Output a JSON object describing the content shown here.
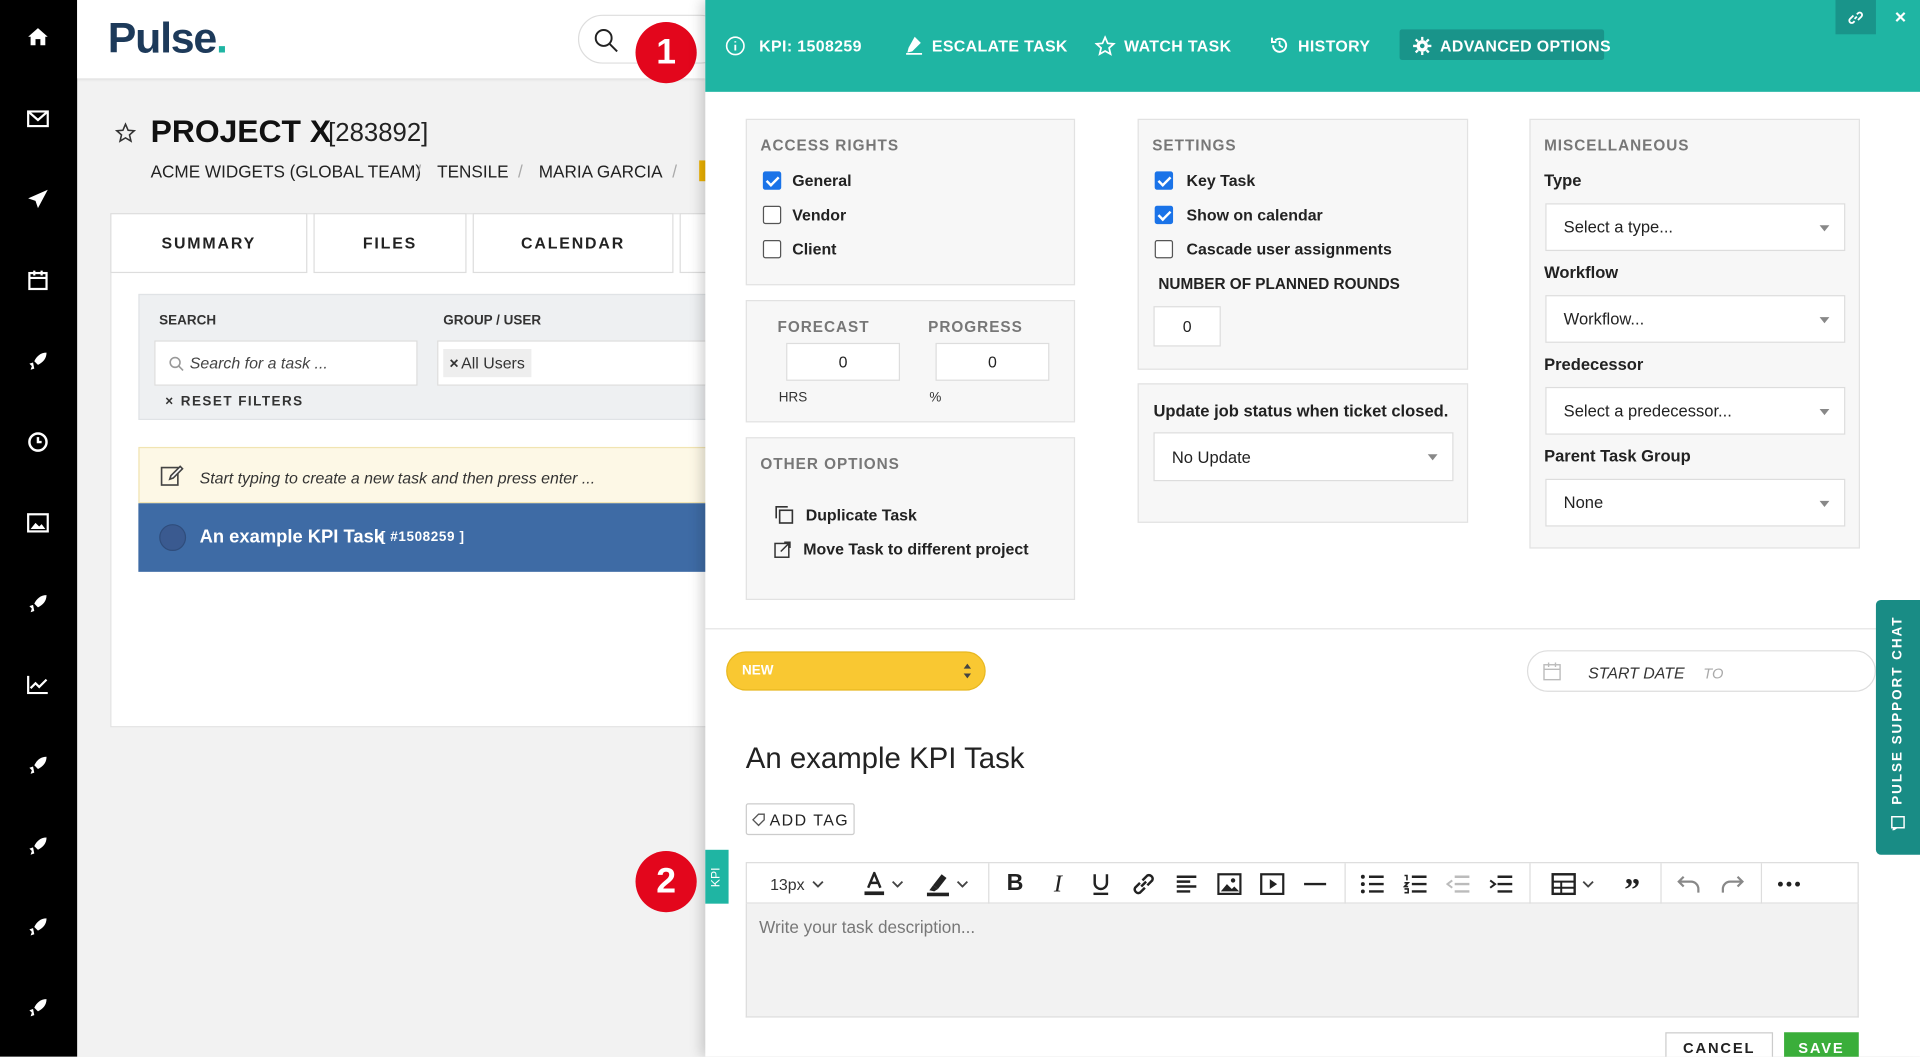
{
  "brand": {
    "name": "Pulse",
    "accent": "#1fb5a3",
    "rail_bg": "#000000"
  },
  "rail_icons": [
    "home-icon",
    "mail-icon",
    "send-icon",
    "calendar-icon",
    "rocket-icon",
    "clock-icon",
    "image-icon",
    "rocket-icon",
    "chart-icon",
    "rocket-icon",
    "rocket-icon",
    "rocket-icon",
    "rocket-icon"
  ],
  "markers": {
    "one": "1",
    "two": "2"
  },
  "project": {
    "title": "PROJECT X",
    "number": "[283892]",
    "breadcrumbs": [
      "ACME WIDGETS (GLOBAL TEAM)",
      "TENSILE",
      "MARIA GARCIA"
    ],
    "tabs": [
      "SUMMARY",
      "FILES",
      "CALENDAR"
    ]
  },
  "filters": {
    "search_label": "SEARCH",
    "search_placeholder": "Search for a task ...",
    "group_label": "GROUP / USER",
    "group_chip": "All Users",
    "reset": "RESET FILTERS"
  },
  "new_task_hint": "Start typing to create a new task and then press enter ...",
  "task_row": {
    "name": "An example KPI Task",
    "id": "[ #1508259 ]"
  },
  "panel": {
    "kpi": "KPI: 1508259",
    "actions": [
      "ESCALATE TASK",
      "WATCH TASK",
      "HISTORY",
      "ADVANCED OPTIONS"
    ],
    "access_rights": {
      "heading": "ACCESS RIGHTS",
      "items": [
        {
          "label": "General",
          "checked": true
        },
        {
          "label": "Vendor",
          "checked": false
        },
        {
          "label": "Client",
          "checked": false
        }
      ]
    },
    "forecast": {
      "label": "FORECAST",
      "value": "0",
      "unit": "HRS"
    },
    "progress": {
      "label": "PROGRESS",
      "value": "0",
      "unit": "%"
    },
    "other_options": {
      "heading": "OTHER OPTIONS",
      "items": [
        "Duplicate Task",
        "Move Task to different project"
      ]
    },
    "settings": {
      "heading": "SETTINGS",
      "items": [
        {
          "label": "Key Task",
          "checked": true
        },
        {
          "label": "Show on calendar",
          "checked": true
        },
        {
          "label": "Cascade user assignments",
          "checked": false
        }
      ],
      "rounds_label": "NUMBER OF PLANNED ROUNDS",
      "rounds_value": "0"
    },
    "job_status": {
      "label": "Update job status when ticket closed.",
      "value": "No Update"
    },
    "misc": {
      "heading": "MISCELLANEOUS",
      "type_label": "Type",
      "type_value": "Select a type...",
      "workflow_label": "Workflow",
      "workflow_value": "Workflow...",
      "predecessor_label": "Predecessor",
      "predecessor_value": "Select a predecessor...",
      "parent_label": "Parent Task Group",
      "parent_value": "None"
    },
    "status": "NEW",
    "start_date": "START DATE",
    "to": "TO",
    "task_title": "An example KPI Task",
    "add_tag": "ADD TAG",
    "kpi_tab": "KPI",
    "editor": {
      "font_size": "13px",
      "placeholder": "Write your task description..."
    },
    "cancel": "CANCEL",
    "save": "SAVE",
    "support_chat": "PULSE SUPPORT CHAT"
  }
}
